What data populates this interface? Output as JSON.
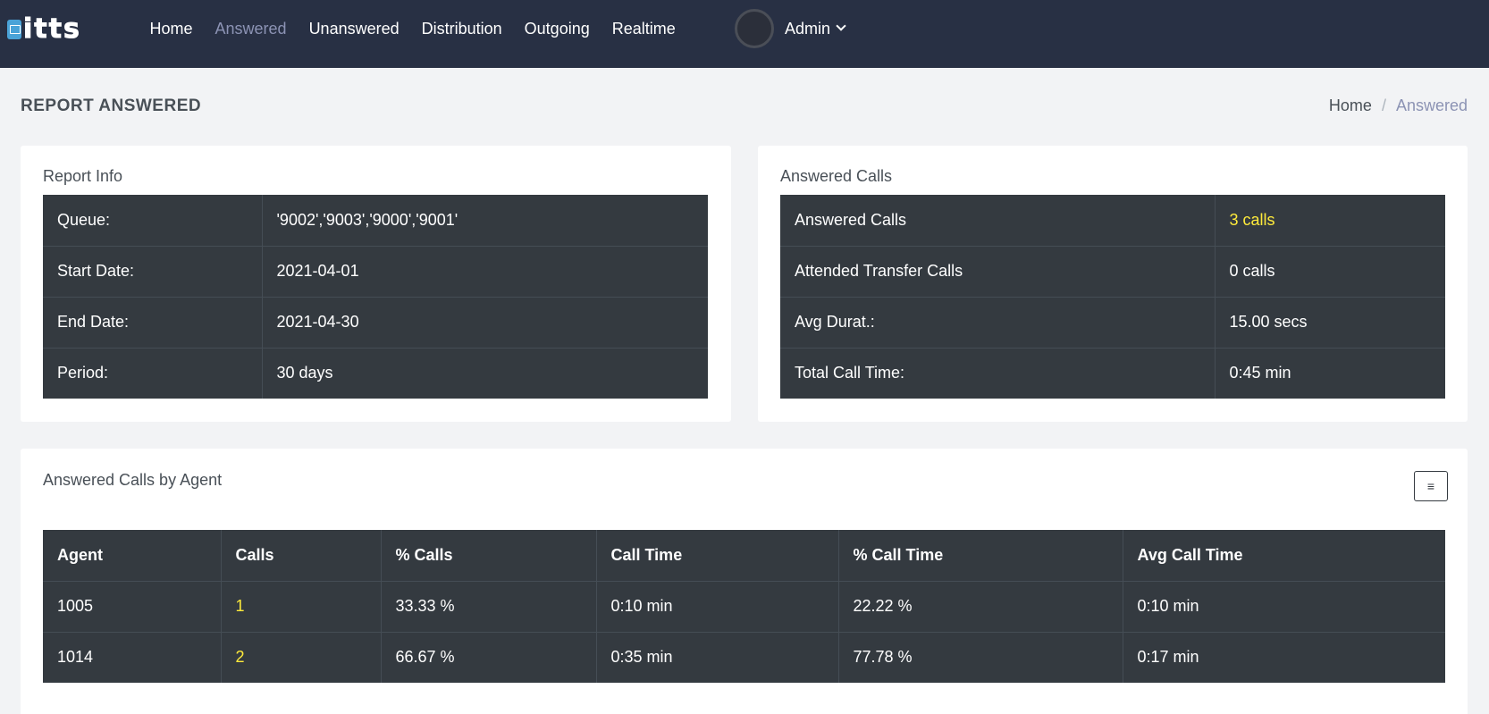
{
  "brand": {
    "name": "itts"
  },
  "nav": {
    "items": [
      {
        "label": "Home",
        "active": false
      },
      {
        "label": "Answered",
        "active": true
      },
      {
        "label": "Unanswered",
        "active": false
      },
      {
        "label": "Distribution",
        "active": false
      },
      {
        "label": "Outgoing",
        "active": false
      },
      {
        "label": "Realtime",
        "active": false
      }
    ],
    "user": "Admin"
  },
  "header": {
    "title": "REPORT ANSWERED",
    "breadcrumb": {
      "home": "Home",
      "separator": "/",
      "current": "Answered"
    }
  },
  "report_info": {
    "title": "Report Info",
    "rows": [
      {
        "label": "Queue:",
        "value": "'9002','9003','9000','9001'"
      },
      {
        "label": "Start Date:",
        "value": "2021-04-01"
      },
      {
        "label": "End Date:",
        "value": "2021-04-30"
      },
      {
        "label": "Period:",
        "value": "30 days"
      }
    ]
  },
  "answered_calls": {
    "title": "Answered Calls",
    "rows": [
      {
        "label": "Answered Calls",
        "value": "3 calls"
      },
      {
        "label": "Attended Transfer Calls",
        "value": "0 calls"
      },
      {
        "label": "Avg Durat.:",
        "value": "15.00 secs"
      },
      {
        "label": "Total Call Time:",
        "value": "0:45 min"
      }
    ]
  },
  "by_agent": {
    "title": "Answered Calls by Agent",
    "menu_icon": "≡",
    "columns": [
      "Agent",
      "Calls",
      "% Calls",
      "Call Time",
      "% Call Time",
      "Avg Call Time"
    ],
    "rows": [
      [
        "1005",
        "1",
        "33.33 %",
        "0:10 min",
        "22.22 %",
        "0:10 min"
      ],
      [
        "1014",
        "2",
        "66.67 %",
        "0:35 min",
        "77.78 %",
        "0:17 min"
      ]
    ]
  },
  "colors": {
    "navbar": "#283044",
    "table": "#343a40",
    "highlight": "#ffeb3b",
    "active_nav": "#8c93b4"
  }
}
